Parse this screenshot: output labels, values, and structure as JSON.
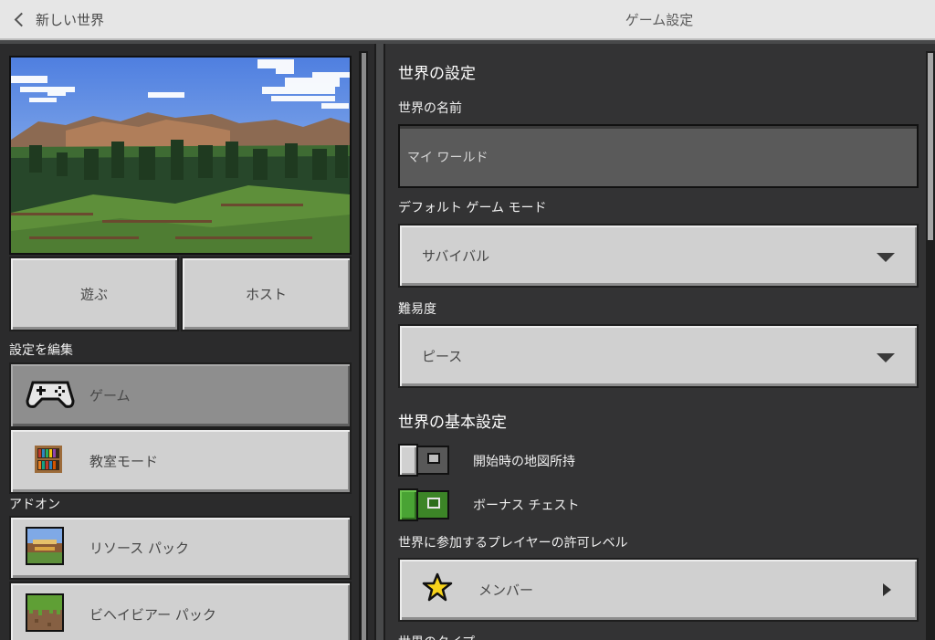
{
  "header": {
    "back_label": "新しい世界",
    "title": "ゲーム設定"
  },
  "left": {
    "play_label": "遊ぶ",
    "host_label": "ホスト",
    "edit_settings_label": "設定を編集",
    "edit_items": [
      {
        "label": "ゲーム",
        "icon": "controller-icon",
        "selected": true
      },
      {
        "label": "教室モード",
        "icon": "bookshelf-icon",
        "selected": false
      }
    ],
    "addons_label": "アドオン",
    "addon_items": [
      {
        "label": "リソース パック",
        "icon": "resource-pack-icon"
      },
      {
        "label": "ビヘイビアー パック",
        "icon": "grass-block-icon"
      }
    ]
  },
  "right": {
    "world_settings_heading": "世界の設定",
    "world_name_label": "世界の名前",
    "world_name_value": "マイ ワールド",
    "game_mode_label": "デフォルト ゲーム モード",
    "game_mode_value": "サバイバル",
    "difficulty_label": "難易度",
    "difficulty_value": "ピース",
    "basic_settings_heading": "世界の基本設定",
    "toggles": [
      {
        "label": "開始時の地図所持",
        "on": false
      },
      {
        "label": "ボーナス チェスト",
        "on": true
      }
    ],
    "permission_label": "世界に参加するプレイヤーの許可レベル",
    "permission_value": "メンバー",
    "world_type_label": "世界のタイプ"
  },
  "colors": {
    "toggle_on": "#3c8527",
    "button_face": "#d0d0d0",
    "button_selected": "#8e8e8e",
    "panel_left": "#2b2b2c",
    "panel_right": "#333334",
    "topbar": "#e6e6e6"
  }
}
